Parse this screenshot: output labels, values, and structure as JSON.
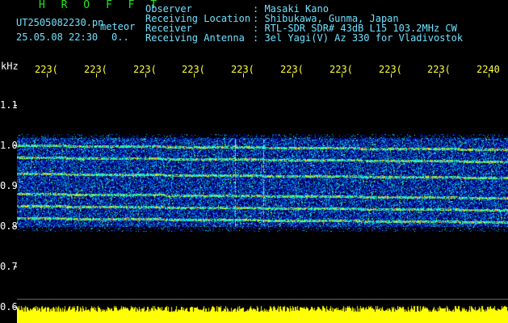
{
  "header": {
    "app_name": "H R O F F T",
    "filename": "UT2505082230.pn",
    "mode": "meteor",
    "datetime": "25.05.08 22:30",
    "counter": "0..",
    "labels": {
      "observer": "Observer",
      "location": "Receiving Location",
      "receiver": "Receiver",
      "antenna": "Receiving Antenna"
    },
    "values": {
      "observer": ": Masaki Kano",
      "location": ": Shibukawa, Gunma, Japan",
      "receiver": ": RTL-SDR SDR# 43dB L15 103.2MHz CW",
      "antenna": ": 3el Yagi(V) Az 330 for Vladivostok"
    }
  },
  "axis": {
    "y_unit": "kHz",
    "y_ticks": [
      "1.1",
      "1.0",
      "0.9",
      "0.8",
      "0.7",
      "0.6"
    ],
    "x_ticks": [
      "223(",
      "223(",
      "223(",
      "223(",
      "223(",
      "223(",
      "223(",
      "223(",
      "223(",
      "2240"
    ]
  },
  "colors": {
    "background": "#000000",
    "title_green": "#22e622",
    "header_cyan": "#6fe0ff",
    "axis_yellow": "#ffff33",
    "signal_strip": "#ffff00"
  },
  "spectrogram": {
    "freq_range_khz": [
      0.6,
      1.15
    ],
    "band_range_khz": [
      0.8,
      1.02
    ],
    "echo_lines_khz": [
      1.0,
      0.97,
      0.93,
      0.88,
      0.85,
      0.82
    ]
  }
}
